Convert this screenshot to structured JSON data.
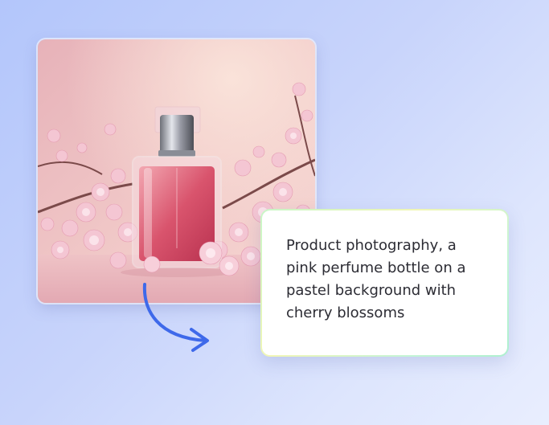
{
  "image": {
    "subject": "pink perfume bottle with cherry blossoms",
    "icon": "photo-icon"
  },
  "caption": {
    "text": "Product photography, a pink perfume bottle on a pastel background with cherry blossoms"
  },
  "colors": {
    "background_start": "#b3c6fb",
    "background_end": "#e9eefe",
    "arrow": "#3e69ea",
    "caption_border_start": "#c8f6c8",
    "caption_border_end": "#aef0cf",
    "caption_text": "#2c2c34"
  }
}
